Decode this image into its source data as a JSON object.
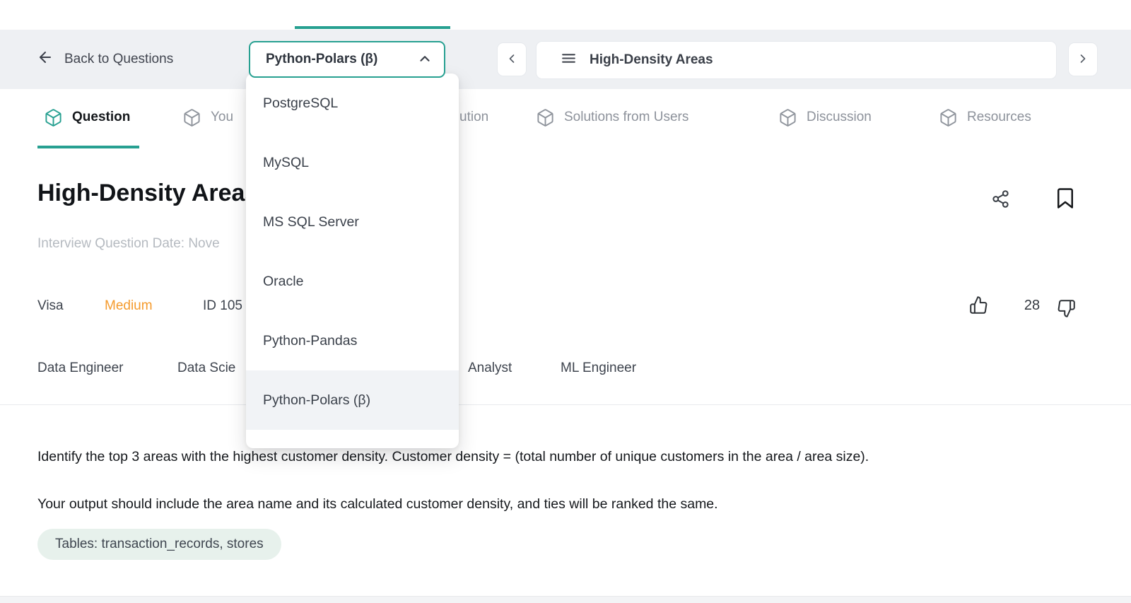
{
  "colors": {
    "accent_teal": "#27A091",
    "difficulty_orange": "#F59B2D",
    "toolbar_bg": "#EEF0F3",
    "tables_badge_bg": "#E7F1EC",
    "selected_option_bg": "#F1F3F6"
  },
  "toolbar": {
    "back_label": "Back to Questions",
    "language_selector_value": "Python-Polars (β)",
    "nav_title": "High-Density Areas"
  },
  "language_dropdown": {
    "options": [
      "PostgreSQL",
      "MySQL",
      "MS SQL Server",
      "Oracle",
      "Python-Pandas",
      "Python-Polars (β)"
    ],
    "selected": "Python-Polars (β)"
  },
  "tabs": {
    "question": "Question",
    "your_solutions_fragment": "You",
    "official_solution_fragment": "ution",
    "solutions_from_users": "Solutions from Users",
    "discussion": "Discussion",
    "resources": "Resources"
  },
  "question": {
    "title": "High-Density Areas",
    "date_fragment": "Interview Question Date: Nove",
    "company": "Visa",
    "difficulty": "Medium",
    "id_fragment": "ID 105",
    "upvote_count": "28",
    "roles": {
      "r1": "Data Engineer",
      "r2_fragment": "Data Scie",
      "r3_fragment": "Analyst",
      "r4": "ML Engineer"
    },
    "body": {
      "p1": "Identify the top 3 areas with the highest customer density. Customer density = (total number of unique customers in the area / area size).",
      "p2": "Your output should include the area name and its calculated customer density, and ties will be ranked the same."
    },
    "tables_badge": "Tables: transaction_records, stores"
  }
}
